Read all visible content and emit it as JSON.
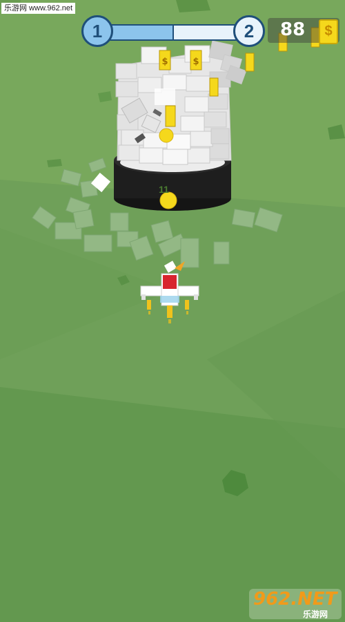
{
  "watermark": {
    "text": "乐游网 www.962.net"
  },
  "level": {
    "current": "1",
    "next": "2",
    "progress": 0.5
  },
  "coins": {
    "count": "88",
    "icon": "coin-dollar-icon",
    "symbol": "$"
  },
  "tower": {
    "hit_points": "11"
  },
  "logo": {
    "brand": "962.NET",
    "subtitle": "乐游网"
  },
  "colors": {
    "ground": "#6f9e55",
    "tower_block": "#eeeeee",
    "tower_base": "#1e1e1e",
    "plane": "#ffffff",
    "cockpit": "#d8242e",
    "ball": "#f5d81c",
    "coin": "#f5d81c"
  }
}
